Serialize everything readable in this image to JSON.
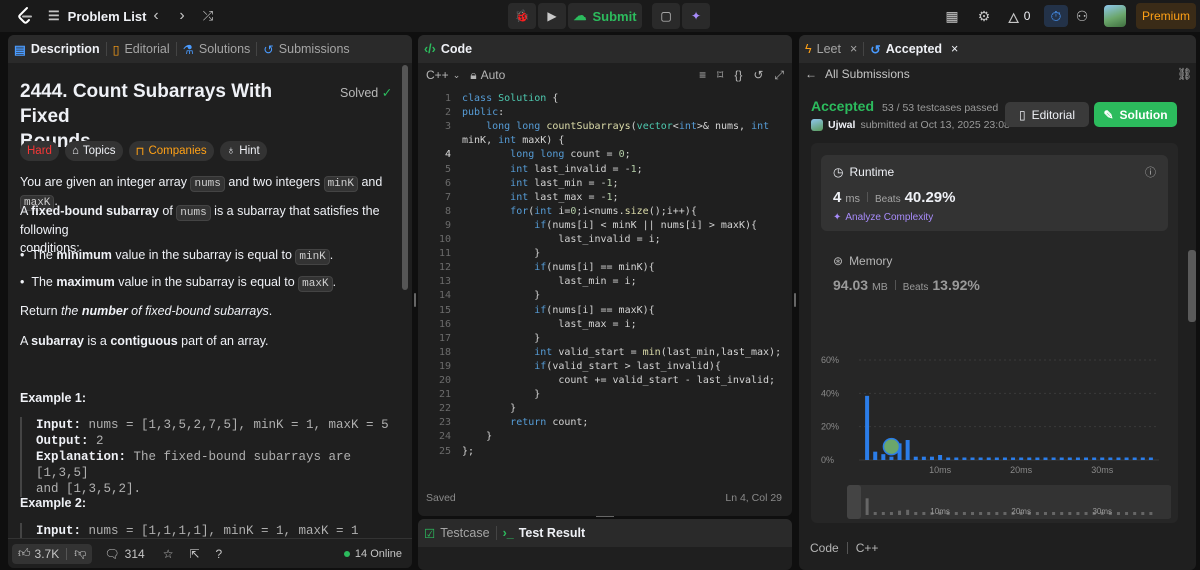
{
  "topbar": {
    "problem_list": "Problem List",
    "submit": "Submit",
    "streak": "0",
    "premium": "Premium"
  },
  "left": {
    "tabs": [
      "Description",
      "Editorial",
      "Solutions",
      "Submissions"
    ],
    "title_line1": "2444. Count Subarrays With Fixed",
    "title_line2": "Bounds",
    "solved": "Solved",
    "tags": [
      "Hard",
      "Topics",
      "Companies",
      "Hint"
    ],
    "p1_a": "You are given an integer array ",
    "p1_nums": "nums",
    "p1_b": " and two integers ",
    "p1_mink": "minK",
    "p1_c": " and ",
    "p1_maxk": "maxK",
    "p1_d": ".",
    "p2_a": "A ",
    "p2_bold": "fixed-bound subarray",
    "p2_b": " of ",
    "p2_nums": "nums",
    "p2_c": " is a subarray that satisfies the following",
    "p2_d": "conditions:",
    "b1_a": "The ",
    "b1_bold": "minimum",
    "b1_b": " value in the subarray is equal to ",
    "b1_code": "minK",
    "b1_c": ".",
    "b2_a": "The ",
    "b2_bold": "maximum",
    "b2_b": " value in the subarray is equal to ",
    "b2_code": "maxK",
    "b2_c": ".",
    "p3_a": "Return ",
    "p3_i1": "the ",
    "p3_bi": "number",
    "p3_i2": " of fixed-bound subarrays",
    "p3_b": ".",
    "p4_a": "A ",
    "p4_bold1": "subarray",
    "p4_b": " is a ",
    "p4_bold2": "contiguous",
    "p4_c": " part of an array.",
    "ex1_head": "Example 1:",
    "ex1_input_label": "Input:",
    "ex1_input": " nums = [1,3,5,2,7,5], minK = 1, maxK = 5",
    "ex1_output_label": "Output:",
    "ex1_output": " 2",
    "ex1_expl_label": "Explanation:",
    "ex1_expl": " The fixed-bound subarrays are [1,3,5]",
    "ex1_expl2": "and [1,3,5,2].",
    "ex2_head": "Example 2:",
    "ex2_input_label": "Input:",
    "ex2_input": " nums = [1,1,1,1], minK = 1, maxK = 1",
    "likes": "3.7K",
    "comments": "314",
    "online": "14 Online"
  },
  "center": {
    "header": "Code",
    "lang": "C++",
    "mode": "Auto",
    "saved": "Saved",
    "cursor": "Ln 4, Col 29",
    "current_line": 4,
    "lines": [
      "class Solution {",
      "public:",
      "    long long countSubarrays(vector<int>& nums, int",
      "minK, int maxK) {",
      "        long long count = 0;",
      "        int last_invalid = -1;",
      "        int last_min = -1;",
      "        int last_max = -1;",
      "        for(int i=0;i<nums.size();i++){",
      "            if(nums[i] < minK || nums[i] > maxK){",
      "                last_invalid = i;",
      "            }",
      "            if(nums[i] == minK){",
      "                last_min = i;",
      "            }",
      "            if(nums[i] == maxK){",
      "                last_max = i;",
      "            }",
      "            int valid_start = min(last_min,last_max);",
      "            if(valid_start > last_invalid){",
      "                count += valid_start - last_invalid;",
      "            }",
      "        }",
      "        return count;",
      "    }",
      "};"
    ],
    "line_numbers": [
      "1",
      "2",
      "3",
      "",
      "4",
      "5",
      "6",
      "7",
      "8",
      "9",
      "10",
      "11",
      "12",
      "13",
      "14",
      "15",
      "16",
      "17",
      "18",
      "19",
      "20",
      "21",
      "22",
      "23",
      "24",
      "25"
    ],
    "test_tabs": [
      "Testcase",
      "Test Result"
    ]
  },
  "right": {
    "tabs": [
      "Leet",
      "Accepted"
    ],
    "back": "All Submissions",
    "status": "Accepted",
    "testcases": "53 / 53 testcases passed",
    "user": "Ujwal",
    "submitted": "submitted at Oct 13, 2025 23:08",
    "editorial_btn": "Editorial",
    "solution_btn": "Solution",
    "runtime_label": "Runtime",
    "runtime_value": "4",
    "runtime_unit": "ms",
    "beats_label": "Beats",
    "runtime_beats": "40.29%",
    "analyze": "Analyze Complexity",
    "memory_label": "Memory",
    "memory_value": "94.03",
    "memory_unit": "MB",
    "memory_beats": "13.92%",
    "code_label": "Code",
    "code_lang": "C++"
  },
  "chart_data": {
    "type": "bar",
    "ylabel": "",
    "xlabel": "",
    "y_ticks": [
      "60%",
      "40%",
      "20%",
      "0%"
    ],
    "ylim": [
      0,
      60
    ],
    "x_ticks": [
      "10ms",
      "20ms",
      "30ms"
    ],
    "x_tick_values": [
      10,
      20,
      30
    ],
    "xlim": [
      0,
      37
    ],
    "bar_x": [
      1,
      2,
      3,
      4,
      5,
      6,
      7,
      8,
      9,
      10,
      11,
      12,
      13,
      14,
      15,
      16,
      17,
      18,
      19,
      20,
      21,
      22,
      23,
      24,
      25,
      26,
      27,
      28,
      29,
      30,
      31,
      32,
      33,
      34,
      35,
      36
    ],
    "values": [
      38.5,
      5,
      3.5,
      2,
      10,
      12,
      2,
      2,
      2,
      3,
      1.5,
      1.5,
      1.5,
      1.5,
      1.5,
      1.5,
      1.5,
      1.5,
      1.5,
      1.5,
      1.5,
      1.5,
      1.5,
      1.5,
      1.5,
      1.5,
      1.5,
      1.5,
      1.5,
      1.5,
      1.5,
      1.5,
      1.5,
      1.5,
      1.5,
      1.5
    ],
    "highlight_x": 4,
    "grid": true,
    "colors": {
      "bar": "#2b7de9",
      "axis": "#8a8a8a"
    }
  },
  "colors": {
    "accepted": "#2cbb5d",
    "hard": "#f63737",
    "brand": "#ffa116"
  }
}
